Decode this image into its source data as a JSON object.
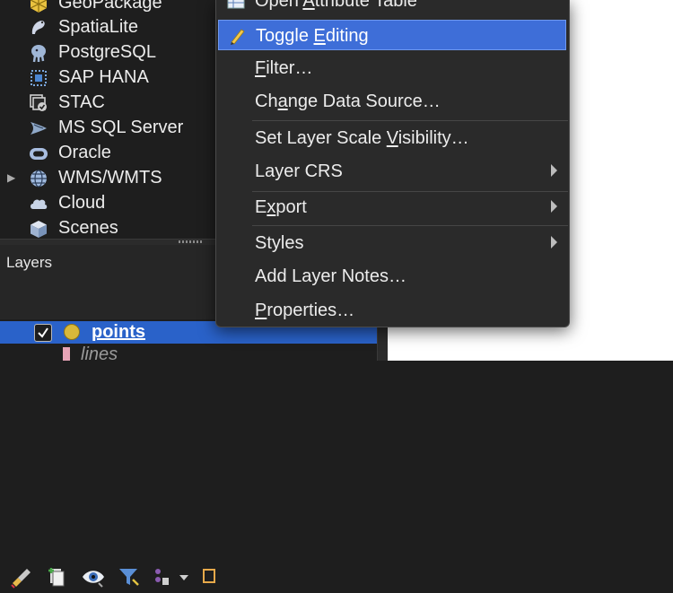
{
  "browser": {
    "items": [
      {
        "label": "GeoPackage",
        "icon": "geopackage-icon",
        "expandable": false
      },
      {
        "label": "SpatiaLite",
        "icon": "spatialite-icon",
        "expandable": false
      },
      {
        "label": "PostgreSQL",
        "icon": "postgresql-icon",
        "expandable": false
      },
      {
        "label": "SAP HANA",
        "icon": "sap-hana-icon",
        "expandable": false
      },
      {
        "label": "STAC",
        "icon": "stac-icon",
        "expandable": false
      },
      {
        "label": "MS SQL Server",
        "icon": "mssql-icon",
        "expandable": false
      },
      {
        "label": "Oracle",
        "icon": "oracle-icon",
        "expandable": false
      },
      {
        "label": "WMS/WMTS",
        "icon": "wms-globe-icon",
        "expandable": true
      },
      {
        "label": "Cloud",
        "icon": "cloud-icon",
        "expandable": false
      },
      {
        "label": "Scenes",
        "icon": "scenes-cube-icon",
        "expandable": false
      }
    ]
  },
  "layers_panel": {
    "title": "Layers",
    "toolbar": [
      "style-brush-icon",
      "add-group-icon",
      "eye-icon",
      "filter-icon",
      "expression-icon",
      "dropdown-icon",
      "expand-icon"
    ],
    "layers": [
      {
        "name": "points",
        "checked": true,
        "selected": true,
        "symbol_color": "#d8b83a"
      },
      {
        "name": "lines",
        "checked": false,
        "selected": false,
        "symbol_color": "#e7a3b6"
      }
    ]
  },
  "context_menu": {
    "items": [
      {
        "pre": "Open ",
        "u": "A",
        "post": "ttribute Table",
        "icon": "table-icon",
        "submenu": false
      },
      {
        "pre": "Toggle ",
        "u": "E",
        "post": "diting",
        "icon": "pencil-icon",
        "submenu": false,
        "highlighted": true
      },
      {
        "pre": "",
        "u": "F",
        "post": "ilter…",
        "submenu": false
      },
      {
        "pre": "Ch",
        "u": "a",
        "post": "nge Data Source…",
        "submenu": false
      },
      {
        "pre": "Set Layer Scale ",
        "u": "V",
        "post": "isibility…",
        "submenu": false
      },
      {
        "pre": "Layer CRS",
        "u": "",
        "post": "",
        "submenu": true
      },
      {
        "pre": "E",
        "u": "x",
        "post": "port",
        "submenu": true
      },
      {
        "pre": "Styles",
        "u": "",
        "post": "",
        "submenu": true
      },
      {
        "pre": "Add Layer Notes…",
        "u": "",
        "post": "",
        "submenu": false
      },
      {
        "pre": "",
        "u": "P",
        "post": "roperties…",
        "submenu": false
      }
    ]
  },
  "colors": {
    "highlight": "#3e6ed8",
    "selected_row": "#2a62c9",
    "menu_bg": "#2a2a2a"
  }
}
